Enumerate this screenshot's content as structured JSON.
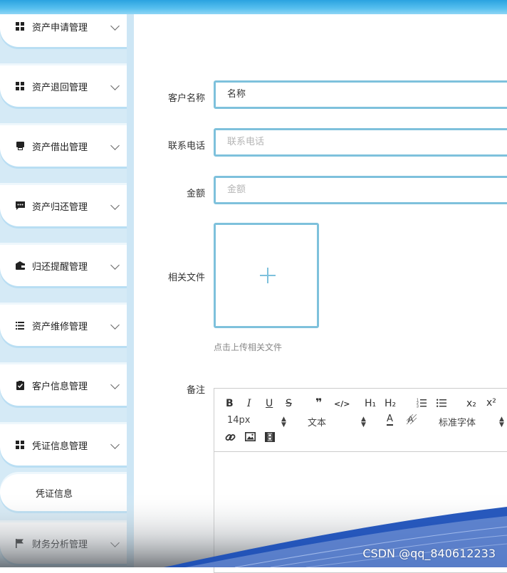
{
  "sidebar": {
    "items": [
      {
        "label": "资产申请管理",
        "icon": "grid-icon"
      },
      {
        "label": "资产退回管理",
        "icon": "grid-icon"
      },
      {
        "label": "资产借出管理",
        "icon": "printer-icon"
      },
      {
        "label": "资产归还管理",
        "icon": "chat-icon"
      },
      {
        "label": "归还提醒管理",
        "icon": "wallet-icon"
      },
      {
        "label": "资产维修管理",
        "icon": "list-icon"
      },
      {
        "label": "客户信息管理",
        "icon": "clipboard-check-icon"
      },
      {
        "label": "凭证信息管理",
        "icon": "grid-icon"
      },
      {
        "label": "财务分析管理",
        "icon": "flag-icon"
      }
    ],
    "sub_item": "凭证信息"
  },
  "form": {
    "name_label": "客户名称",
    "name_value": "名称",
    "phone_label": "联系电话",
    "phone_placeholder": "联系电话",
    "amount_label": "金额",
    "amount_placeholder": "金额",
    "file_label": "相关文件",
    "file_hint": "点击上传相关文件",
    "note_label": "备注"
  },
  "editor": {
    "font_size": "14px",
    "paragraph": "文本",
    "font_family": "标准字体",
    "buttons": {
      "bold": "B",
      "italic": "I",
      "underline": "U",
      "strike": "S",
      "quote": "❞",
      "code": "</>",
      "h1": "H₁",
      "h2": "H₂",
      "subscript": "x₂",
      "superscript": "x²",
      "font_color": "A"
    }
  },
  "watermark": "CSDN @qq_840612233",
  "colors": {
    "accent": "#7ec1dc",
    "topbar": "#2aa3e0",
    "sidebar_bg": "#d5eaf6"
  }
}
